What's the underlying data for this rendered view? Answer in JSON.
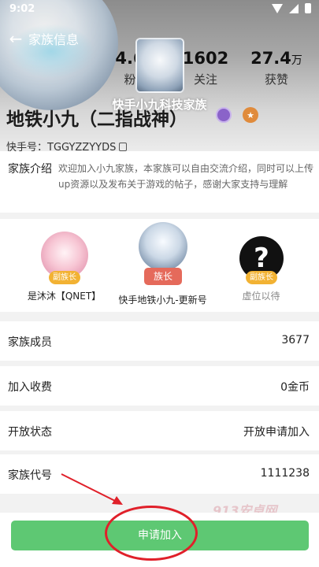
{
  "status_bar": {
    "time": "9:02"
  },
  "nav": {
    "title": "家族信息"
  },
  "profile": {
    "stats": [
      {
        "value": "4.6",
        "label": "粉"
      },
      {
        "value": "1602",
        "label": "关注"
      },
      {
        "value": "27.4",
        "unit": "万",
        "label": "获赞"
      }
    ],
    "family_name": "快手小九科技家族",
    "user_name": "地铁小九（二指战神）",
    "kuaishou_id": "快手号：TGGYZZYYDS"
  },
  "intro": {
    "label": "家族介绍",
    "text": "欢迎加入小九家族，本家族可以自由交流介绍，同时可以上传up资源以及发布关于游戏的帖子，感谢大家支持与理解"
  },
  "members": [
    {
      "name": "是沐沐【QNET】",
      "role": "副族长"
    },
    {
      "name": "快手地铁小九-更新号",
      "role": "族长"
    },
    {
      "name": "虚位以待",
      "role": "副族长",
      "avatar_glyph": "?"
    }
  ],
  "info_rows": [
    {
      "label": "家族成员",
      "value": "3677"
    },
    {
      "label": "加入收费",
      "value": "0金币"
    },
    {
      "label": "开放状态",
      "value": "开放申请加入"
    },
    {
      "label": "家族代号",
      "value": "1111238"
    }
  ],
  "watermark": "913安卓网",
  "join_button": {
    "label": "申请加入"
  },
  "colors": {
    "accent_green": "#5ec873",
    "leader_badge": "#e56a5b",
    "deputy_badge": "#f2b233",
    "annotation_red": "#e0202a"
  }
}
